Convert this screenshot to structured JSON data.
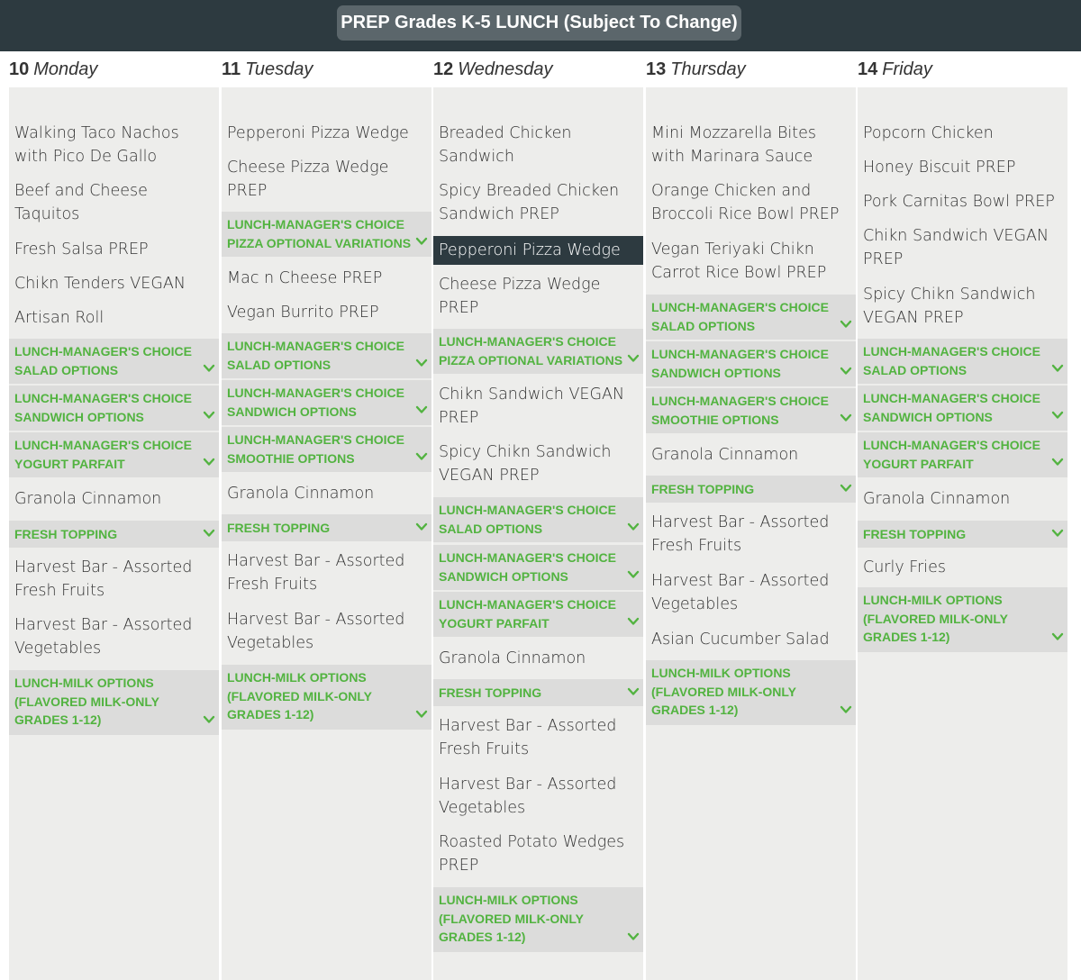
{
  "header": {
    "title": "PREP Grades K-5 LUNCH (Subject To Change)"
  },
  "days": [
    {
      "num": "10",
      "name": "Monday",
      "items": [
        {
          "type": "item",
          "text": "Walking Taco Nachos with Pico De Gallo"
        },
        {
          "type": "item",
          "text": "Beef and Cheese Taquitos"
        },
        {
          "type": "item",
          "text": "Fresh Salsa PREP"
        },
        {
          "type": "item",
          "text": "Chikn Tenders VEGAN"
        },
        {
          "type": "item",
          "text": "Artisan Roll"
        },
        {
          "type": "cat",
          "text": "LUNCH-MANAGER'S CHOICE SALAD OPTIONS"
        },
        {
          "type": "cat",
          "text": "LUNCH-MANAGER'S CHOICE SANDWICH OPTIONS"
        },
        {
          "type": "cat",
          "text": "LUNCH-MANAGER'S CHOICE YOGURT PARFAIT"
        },
        {
          "type": "item",
          "text": "Granola Cinnamon"
        },
        {
          "type": "cat",
          "text": "FRESH TOPPING"
        },
        {
          "type": "item",
          "text": "Harvest Bar - Assorted Fresh Fruits"
        },
        {
          "type": "item",
          "text": "Harvest Bar - Assorted Vegetables"
        },
        {
          "type": "cat",
          "text": "LUNCH-MILK OPTIONS (FLAVORED MILK-ONLY GRADES 1-12)"
        }
      ]
    },
    {
      "num": "11",
      "name": "Tuesday",
      "items": [
        {
          "type": "item",
          "text": "Pepperoni Pizza Wedge"
        },
        {
          "type": "item",
          "text": "Cheese Pizza Wedge PREP"
        },
        {
          "type": "cat",
          "text": "LUNCH-MANAGER'S CHOICE PIZZA OPTIONAL VARIATIONS"
        },
        {
          "type": "item",
          "text": "Mac n Cheese PREP"
        },
        {
          "type": "item",
          "text": "Vegan Burrito PREP"
        },
        {
          "type": "cat",
          "text": "LUNCH-MANAGER'S CHOICE SALAD OPTIONS"
        },
        {
          "type": "cat",
          "text": "LUNCH-MANAGER'S CHOICE SANDWICH OPTIONS"
        },
        {
          "type": "cat",
          "text": "LUNCH-MANAGER'S CHOICE SMOOTHIE OPTIONS"
        },
        {
          "type": "item",
          "text": "Granola Cinnamon"
        },
        {
          "type": "cat",
          "text": "FRESH TOPPING"
        },
        {
          "type": "item",
          "text": "Harvest Bar - Assorted Fresh Fruits"
        },
        {
          "type": "item",
          "text": "Harvest Bar - Assorted Vegetables"
        },
        {
          "type": "cat",
          "text": "LUNCH-MILK OPTIONS (FLAVORED MILK-ONLY GRADES 1-12)"
        }
      ]
    },
    {
      "num": "12",
      "name": "Wednesday",
      "items": [
        {
          "type": "item",
          "text": "Breaded Chicken Sandwich"
        },
        {
          "type": "item",
          "text": "Spicy Breaded Chicken Sandwich PREP"
        },
        {
          "type": "item",
          "text": "Pepperoni Pizza Wedge",
          "highlight": true
        },
        {
          "type": "item",
          "text": "Cheese Pizza Wedge PREP"
        },
        {
          "type": "cat",
          "text": "LUNCH-MANAGER'S CHOICE PIZZA OPTIONAL VARIATIONS"
        },
        {
          "type": "item",
          "text": "Chikn Sandwich VEGAN PREP"
        },
        {
          "type": "item",
          "text": "Spicy Chikn Sandwich VEGAN PREP"
        },
        {
          "type": "cat",
          "text": "LUNCH-MANAGER'S CHOICE SALAD OPTIONS"
        },
        {
          "type": "cat",
          "text": "LUNCH-MANAGER'S CHOICE SANDWICH OPTIONS"
        },
        {
          "type": "cat",
          "text": "LUNCH-MANAGER'S CHOICE YOGURT PARFAIT"
        },
        {
          "type": "item",
          "text": "Granola Cinnamon"
        },
        {
          "type": "cat",
          "text": "FRESH TOPPING"
        },
        {
          "type": "item",
          "text": "Harvest Bar - Assorted Fresh Fruits"
        },
        {
          "type": "item",
          "text": "Harvest Bar - Assorted Vegetables"
        },
        {
          "type": "item",
          "text": "Roasted Potato Wedges PREP"
        },
        {
          "type": "cat",
          "text": "LUNCH-MILK OPTIONS (FLAVORED MILK-ONLY GRADES 1-12)"
        }
      ]
    },
    {
      "num": "13",
      "name": "Thursday",
      "items": [
        {
          "type": "item",
          "text": "Mini Mozzarella Bites with Marinara Sauce"
        },
        {
          "type": "item",
          "text": "Orange Chicken and Broccoli Rice Bowl PREP"
        },
        {
          "type": "item",
          "text": "Vegan Teriyaki Chikn Carrot Rice Bowl PREP"
        },
        {
          "type": "cat",
          "text": "LUNCH-MANAGER'S CHOICE SALAD OPTIONS"
        },
        {
          "type": "cat",
          "text": "LUNCH-MANAGER'S CHOICE SANDWICH OPTIONS"
        },
        {
          "type": "cat",
          "text": "LUNCH-MANAGER'S CHOICE SMOOTHIE OPTIONS"
        },
        {
          "type": "item",
          "text": "Granola Cinnamon"
        },
        {
          "type": "cat",
          "text": "FRESH TOPPING"
        },
        {
          "type": "item",
          "text": "Harvest Bar - Assorted Fresh Fruits"
        },
        {
          "type": "item",
          "text": "Harvest Bar - Assorted Vegetables"
        },
        {
          "type": "item",
          "text": "Asian Cucumber Salad"
        },
        {
          "type": "cat",
          "text": "LUNCH-MILK OPTIONS (FLAVORED MILK-ONLY GRADES 1-12)"
        }
      ]
    },
    {
      "num": "14",
      "name": "Friday",
      "items": [
        {
          "type": "item",
          "text": "Popcorn Chicken"
        },
        {
          "type": "item",
          "text": "Honey Biscuit PREP"
        },
        {
          "type": "item",
          "text": "Pork Carnitas Bowl PREP"
        },
        {
          "type": "item",
          "text": "Chikn Sandwich VEGAN PREP"
        },
        {
          "type": "item",
          "text": "Spicy Chikn Sandwich VEGAN PREP"
        },
        {
          "type": "cat",
          "text": "LUNCH-MANAGER'S CHOICE SALAD OPTIONS"
        },
        {
          "type": "cat",
          "text": "LUNCH-MANAGER'S CHOICE SANDWICH OPTIONS"
        },
        {
          "type": "cat",
          "text": "LUNCH-MANAGER'S CHOICE YOGURT PARFAIT"
        },
        {
          "type": "item",
          "text": "Granola Cinnamon"
        },
        {
          "type": "cat",
          "text": "FRESH TOPPING"
        },
        {
          "type": "item",
          "text": "Curly Fries"
        },
        {
          "type": "cat",
          "text": "LUNCH-MILK OPTIONS (FLAVORED MILK-ONLY GRADES 1-12)"
        }
      ]
    }
  ],
  "colors": {
    "header_bg": "#2d3a40",
    "accent_green": "#52b340",
    "highlight_bg": "#2d3a40"
  },
  "icons": {
    "category_toggle": "chevron-down-icon"
  }
}
